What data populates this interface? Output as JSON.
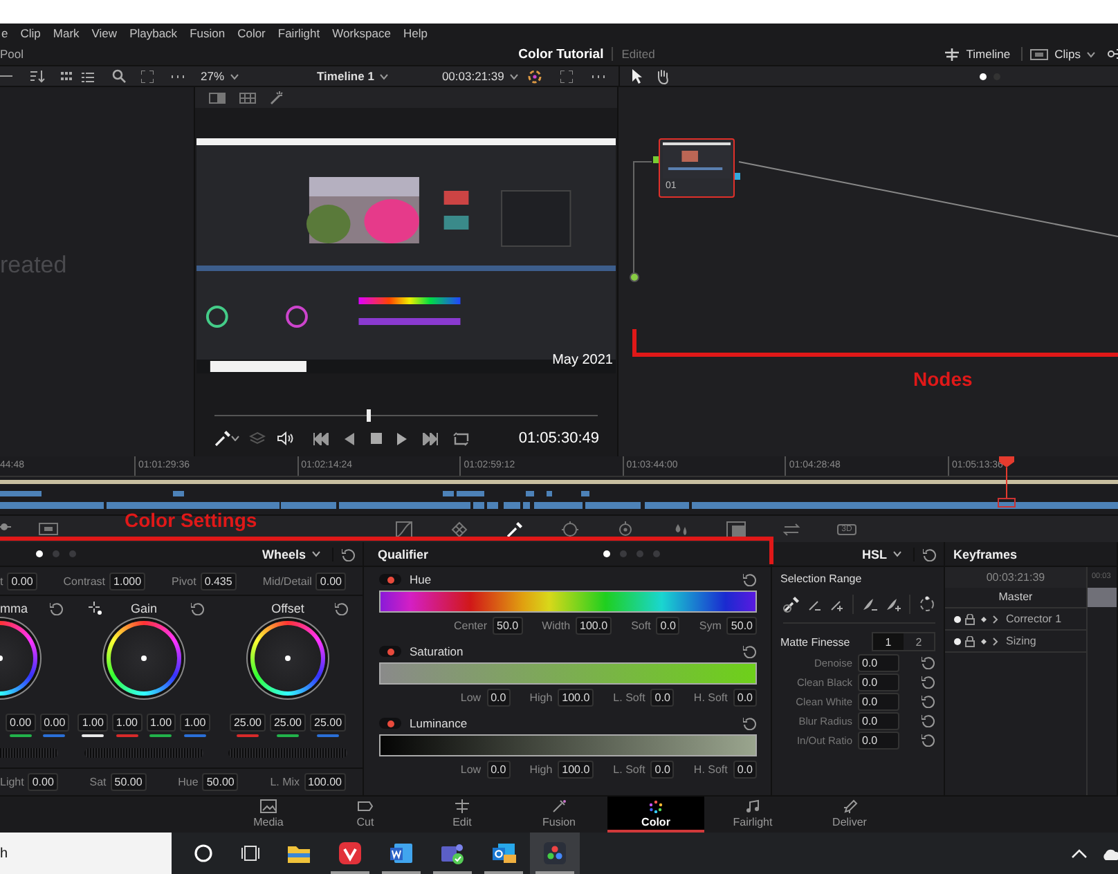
{
  "menu_bar": [
    "e",
    "Clip",
    "Mark",
    "View",
    "Playback",
    "Fusion",
    "Color",
    "Fairlight",
    "Workspace",
    "Help"
  ],
  "title_bar": {
    "left": "Pool",
    "project": "Color Tutorial",
    "status": "Edited",
    "buttons": [
      "Timeline",
      "Clips"
    ]
  },
  "toolbar": {
    "zoom": "27%",
    "timeline": "Timeline 1",
    "timecode": "00:03:21:39",
    "node_dots": [
      {
        "selected": true
      },
      {
        "selected": false
      }
    ]
  },
  "gallery": {
    "message": "reated"
  },
  "viewer": {
    "overlay_text": "May 2021",
    "scrub": {
      "level": 0.4
    },
    "timecode": "01:05:30:49"
  },
  "node_editor": {
    "nodes": [
      {
        "label": "01",
        "selected": true
      }
    ],
    "annotation": "Nodes"
  },
  "timeline": {
    "ticks": [
      "44:48",
      "01:01:29:36",
      "01:02:14:24",
      "01:02:59:12",
      "01:03:44:00",
      "01:04:28:48",
      "01:05:13:36"
    ],
    "playhead": {
      "level": 0.9
    }
  },
  "palette": {
    "annotation": "Color Settings",
    "tools": [
      {
        "kind": "curves",
        "selected": false
      },
      {
        "kind": "warper",
        "selected": false
      },
      {
        "kind": "qualifier",
        "selected": true
      },
      {
        "kind": "window",
        "selected": false
      },
      {
        "kind": "tracker",
        "selected": false
      },
      {
        "kind": "blur",
        "selected": false
      },
      {
        "kind": "key",
        "selected": false
      },
      {
        "kind": "sizing",
        "selected": false
      },
      {
        "kind": "stereo",
        "selected": false,
        "label": "3D"
      }
    ]
  },
  "primaries": {
    "mode": "Wheels",
    "page_dots": [
      {
        "selected": true
      },
      {
        "selected": false
      },
      {
        "selected": false
      }
    ],
    "adjustments": [
      {
        "label": "t",
        "value": "0.00"
      },
      {
        "label": "Contrast",
        "value": "1.000"
      },
      {
        "label": "Pivot",
        "value": "0.435"
      },
      {
        "label": "Mid/Detail",
        "value": "0.00"
      }
    ],
    "wheels": [
      {
        "name": "mma",
        "values": [
          {
            "value": "0.00",
            "color": "#22b24a"
          },
          {
            "value": "0.00",
            "color": "#2a6fd6"
          }
        ]
      },
      {
        "name": "Gain",
        "values": [
          {
            "value": "1.00",
            "color": "#e8e8e8"
          },
          {
            "value": "1.00",
            "color": "#d62a2a"
          },
          {
            "value": "1.00",
            "color": "#22b24a"
          },
          {
            "value": "1.00",
            "color": "#2a6fd6"
          }
        ]
      },
      {
        "name": "Offset",
        "values": [
          {
            "value": "25.00",
            "color": "#d62a2a"
          },
          {
            "value": "25.00",
            "color": "#22b24a"
          },
          {
            "value": "25.00",
            "color": "#2a6fd6"
          }
        ]
      }
    ],
    "bottom": [
      {
        "label": "Light",
        "value": "0.00"
      },
      {
        "label": "Sat",
        "value": "50.00"
      },
      {
        "label": "Hue",
        "value": "50.00"
      },
      {
        "label": "L. Mix",
        "value": "100.00"
      }
    ]
  },
  "qualifier": {
    "title": "Qualifier",
    "page_dots": [
      {
        "selected": true
      },
      {
        "selected": false
      },
      {
        "selected": false
      },
      {
        "selected": false
      }
    ],
    "channels": [
      {
        "name": "Hue",
        "kind": "hue",
        "enabled": true,
        "fields": [
          {
            "label": "Center",
            "value": "50.0"
          },
          {
            "label": "Width",
            "value": "100.0"
          },
          {
            "label": "Soft",
            "value": "0.0"
          },
          {
            "label": "Sym",
            "value": "50.0"
          }
        ]
      },
      {
        "name": "Saturation",
        "kind": "saturation",
        "enabled": true,
        "fields": [
          {
            "label": "Low",
            "value": "0.0"
          },
          {
            "label": "High",
            "value": "100.0"
          },
          {
            "label": "L. Soft",
            "value": "0.0"
          },
          {
            "label": "H. Soft",
            "value": "0.0"
          }
        ]
      },
      {
        "name": "Luminance",
        "kind": "luminance",
        "enabled": true,
        "fields": [
          {
            "label": "Low",
            "value": "0.0"
          },
          {
            "label": "High",
            "value": "100.0"
          },
          {
            "label": "L. Soft",
            "value": "0.0"
          },
          {
            "label": "H. Soft",
            "value": "0.0"
          }
        ]
      }
    ]
  },
  "hsl": {
    "mode": "HSL",
    "selection_range": "Selection Range",
    "matte_finesse": "Matte Finesse",
    "matte_tabs": [
      {
        "label": "1",
        "selected": true
      },
      {
        "label": "2",
        "selected": false
      }
    ],
    "fields": [
      {
        "label": "Denoise",
        "value": "0.0"
      },
      {
        "label": "Clean Black",
        "value": "0.0"
      },
      {
        "label": "Clean White",
        "value": "0.0"
      },
      {
        "label": "Blur Radius",
        "value": "0.0"
      },
      {
        "label": "In/Out Ratio",
        "value": "0.0"
      }
    ]
  },
  "keyframes": {
    "title": "Keyframes",
    "timecode": "00:03:21:39",
    "ruler_label": "00:03",
    "master": "Master",
    "rows": [
      {
        "label": "Corrector 1"
      },
      {
        "label": "Sizing"
      }
    ]
  },
  "pages": [
    {
      "label": "Media",
      "kind": "media",
      "selected": false
    },
    {
      "label": "Cut",
      "kind": "cut",
      "selected": false
    },
    {
      "label": "Edit",
      "kind": "edit",
      "selected": false
    },
    {
      "label": "Fusion",
      "kind": "fusion",
      "selected": false
    },
    {
      "label": "Color",
      "kind": "color",
      "selected": true
    },
    {
      "label": "Fairlight",
      "kind": "fairlight",
      "selected": false
    },
    {
      "label": "Deliver",
      "kind": "deliver",
      "selected": false
    }
  ],
  "taskbar": {
    "search_text": "h",
    "apps": [
      {
        "kind": "explorer",
        "running": false,
        "active": false
      },
      {
        "kind": "vivaldi",
        "running": true,
        "active": false
      },
      {
        "kind": "word",
        "running": true,
        "active": false
      },
      {
        "kind": "teams",
        "running": true,
        "active": false
      },
      {
        "kind": "outlook",
        "running": true,
        "active": false
      },
      {
        "kind": "resolve",
        "running": true,
        "active": true
      }
    ]
  }
}
